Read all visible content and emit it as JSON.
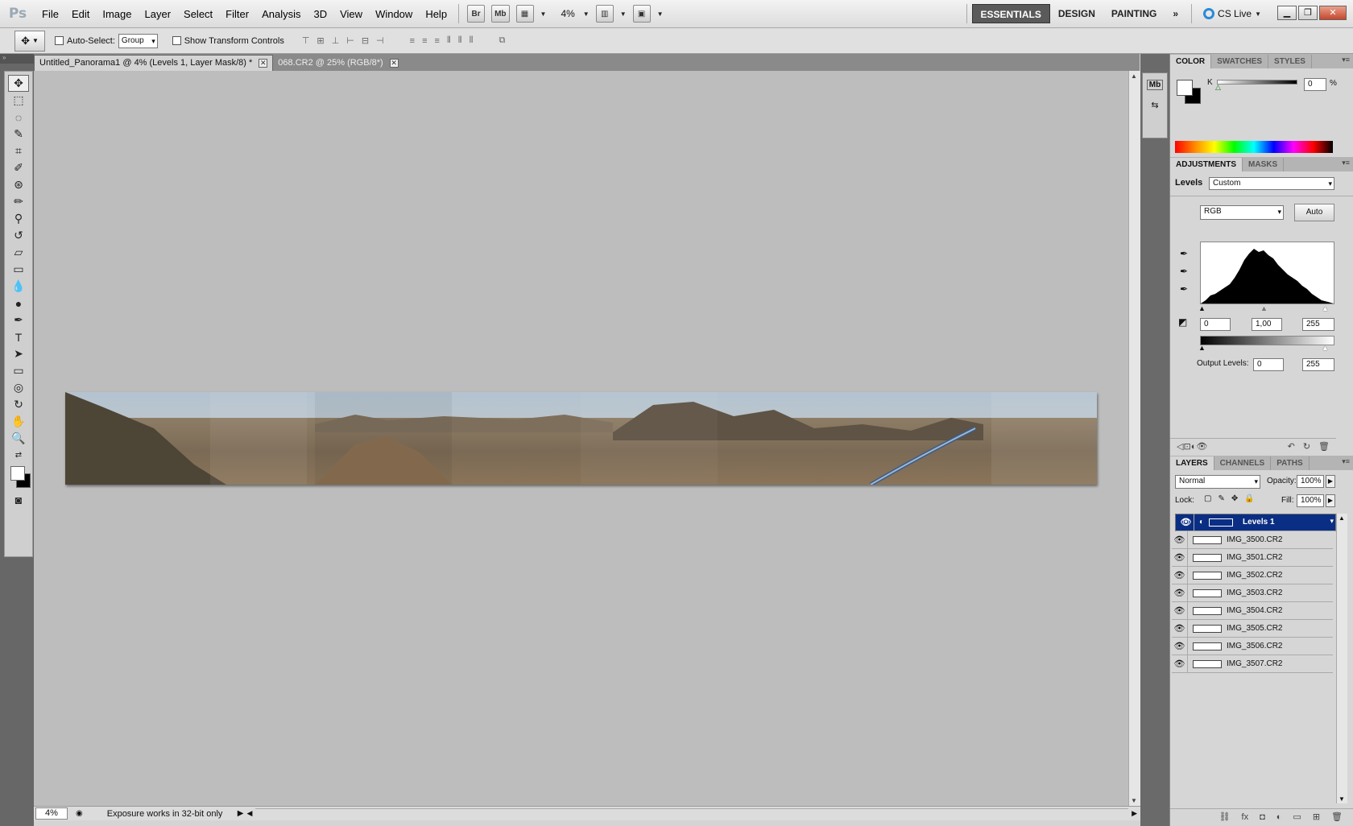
{
  "app": {
    "logo": "Ps"
  },
  "menu": [
    "File",
    "Edit",
    "Image",
    "Layer",
    "Select",
    "Filter",
    "Analysis",
    "3D",
    "View",
    "Window",
    "Help"
  ],
  "appbar": {
    "bridge": "Br",
    "minibridge": "Mb",
    "zoom": "4%"
  },
  "workspaces": [
    "ESSENTIALS",
    "DESIGN",
    "PAINTING"
  ],
  "workspace_more": "»",
  "cslive": "CS Live",
  "options": {
    "auto_select_label": "Auto-Select:",
    "auto_select_value": "Group",
    "show_transform_label": "Show Transform Controls"
  },
  "tabs": [
    {
      "title": "Untitled_Panorama1 @ 4% (Levels 1, Layer Mask/8) *",
      "active": true
    },
    {
      "title": "068.CR2 @ 25% (RGB/8*)",
      "active": false
    }
  ],
  "status": {
    "zoom": "4%",
    "message": "Exposure works in 32-bit only"
  },
  "color_panel": {
    "tabs": [
      "COLOR",
      "SWATCHES",
      "STYLES"
    ],
    "channel": "K",
    "value": "0",
    "unit": "%"
  },
  "adjustments_panel": {
    "tabs": [
      "ADJUSTMENTS",
      "MASKS"
    ],
    "title": "Levels",
    "preset": "Custom",
    "channel": "RGB",
    "auto_label": "Auto",
    "input_black": "0",
    "input_gamma": "1,00",
    "input_white": "255",
    "output_label": "Output Levels:",
    "output_black": "0",
    "output_white": "255"
  },
  "layers_panel": {
    "tabs": [
      "LAYERS",
      "CHANNELS",
      "PATHS"
    ],
    "blend_mode": "Normal",
    "opacity_label": "Opacity:",
    "opacity": "100%",
    "lock_label": "Lock:",
    "fill_label": "Fill:",
    "fill": "100%",
    "layers": [
      {
        "name": "Levels 1",
        "selected": true
      },
      {
        "name": "IMG_3500.CR2",
        "selected": false
      },
      {
        "name": "IMG_3501.CR2",
        "selected": false
      },
      {
        "name": "IMG_3502.CR2",
        "selected": false
      },
      {
        "name": "IMG_3503.CR2",
        "selected": false
      },
      {
        "name": "IMG_3504.CR2",
        "selected": false
      },
      {
        "name": "IMG_3505.CR2",
        "selected": false
      },
      {
        "name": "IMG_3506.CR2",
        "selected": false
      },
      {
        "name": "IMG_3507.CR2",
        "selected": false
      }
    ]
  },
  "colors": {
    "selected_layer": "#0a2e83",
    "canvas_bg": "#bdbdbd"
  }
}
